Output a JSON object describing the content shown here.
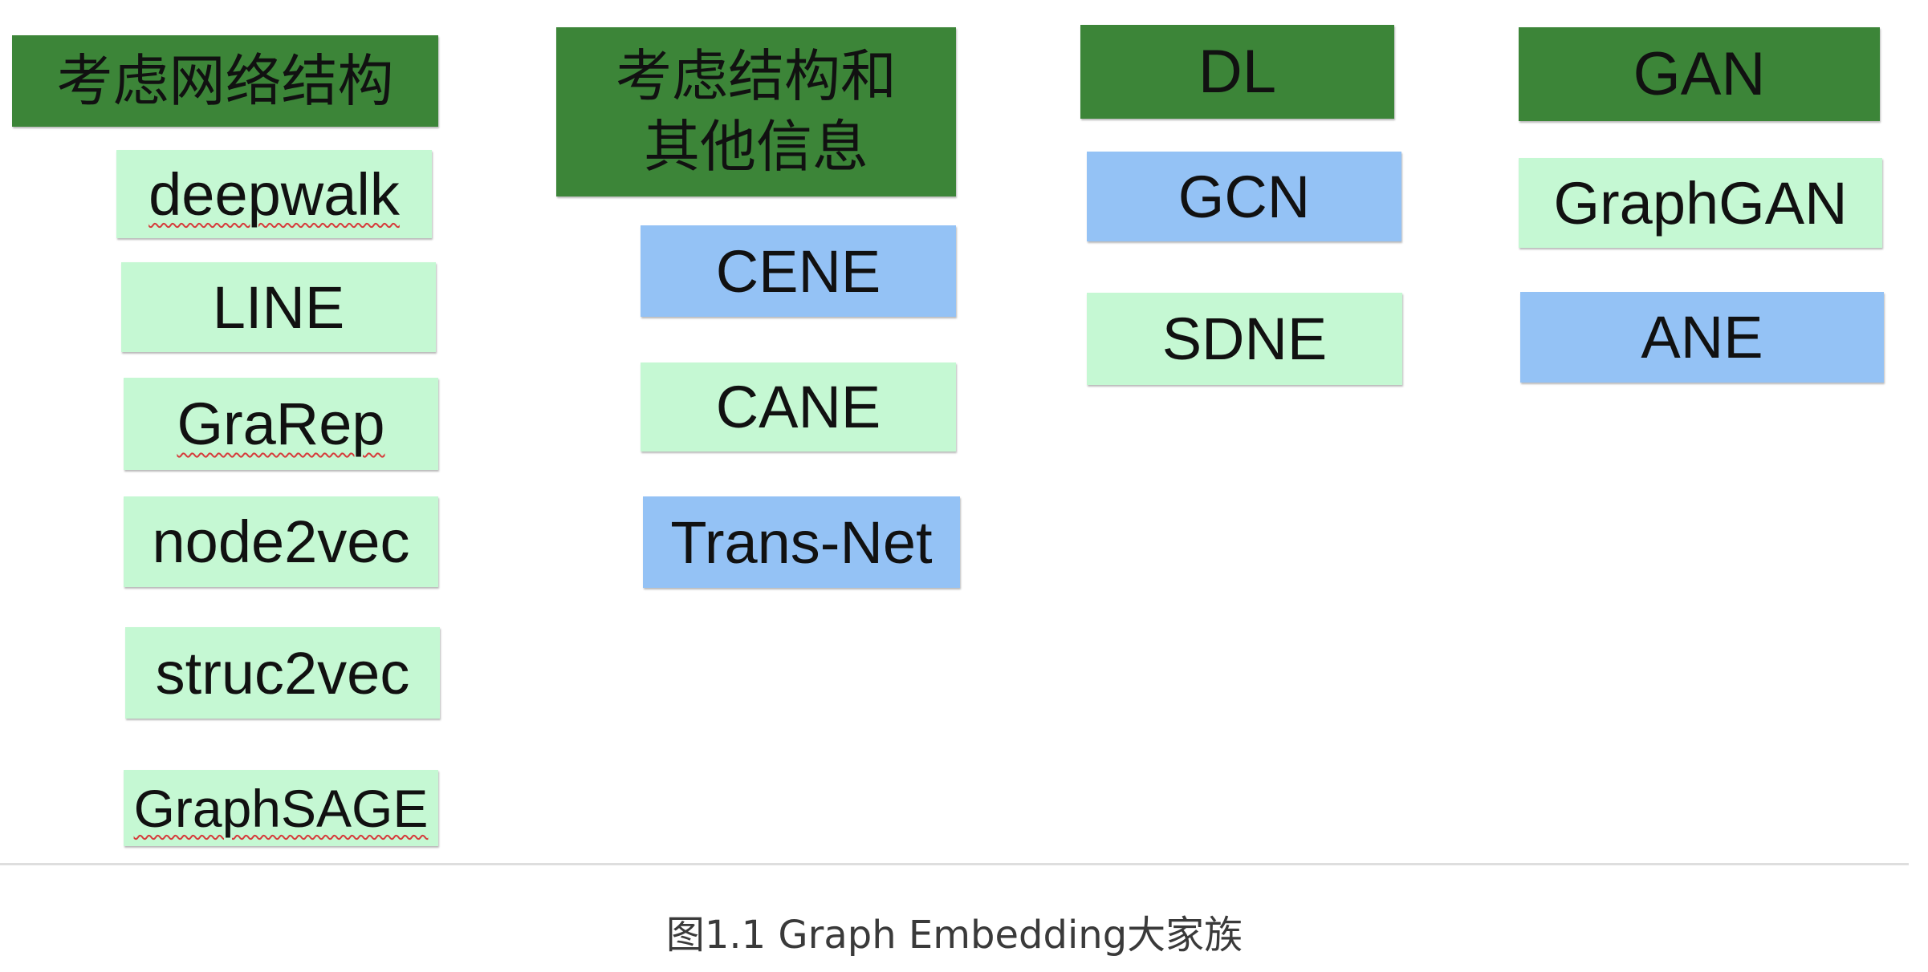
{
  "columns": [
    {
      "header": "考虑网络结构",
      "methods": [
        "deepwalk",
        "LINE",
        "GraRep",
        "node2vec",
        "struc2vec",
        "GraphSAGE"
      ]
    },
    {
      "header_line1": "考虑结构和",
      "header_line2": "其他信息",
      "methods": [
        "CENE",
        "CANE",
        "Trans-Net"
      ]
    },
    {
      "header": "DL",
      "methods": [
        "GCN",
        "SDNE"
      ]
    },
    {
      "header": "GAN",
      "methods": [
        "GraphGAN",
        "ANE"
      ]
    }
  ],
  "caption": "图1.1 Graph Embedding大家族",
  "colors": {
    "header_green": "#3c8538",
    "light_green": "#c5f8d3",
    "blue": "#94c2f5"
  }
}
